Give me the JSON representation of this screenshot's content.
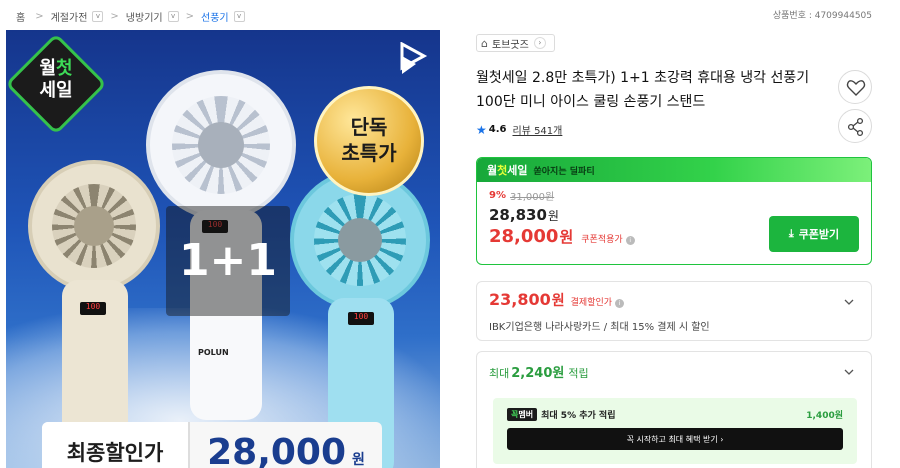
{
  "breadcrumb": {
    "items": [
      {
        "label": "홈"
      },
      {
        "label": "계절가전"
      },
      {
        "label": "냉방기기"
      },
      {
        "label": "선풍기"
      }
    ],
    "dropdown_glyph": "v"
  },
  "product_number": "상품번호 : 4709944505",
  "hero": {
    "badge_month_line1_a": "월",
    "badge_month_line1_b": "첫",
    "badge_month_line2": "세일",
    "badge_exclusive_line1": "단독",
    "badge_exclusive_line2": "초특가",
    "center_text": "1+1",
    "fan_display": "100",
    "fan_brand": "POLUN",
    "price_label": "최종할인가",
    "price_value": "28,000",
    "price_unit": "원"
  },
  "store": {
    "name": "토브굿즈",
    "arrow": "›"
  },
  "product": {
    "title": "월첫세일 2.8만 초특가) 1+1 초강력 휴대용 냉각 선풍기 100단 미니 아이스 쿨링 손풍기 스탠드",
    "rating": "4.6",
    "reviews_label": "리뷰 541개"
  },
  "deal": {
    "header_a": "월",
    "header_b": "첫",
    "header_c": "세일",
    "header_sub": "쏟아지는 딜파티",
    "discount_pct": "9%",
    "original_price": "31,000원",
    "current_price": "28,830",
    "current_unit": "원",
    "coupon_price": "28,000",
    "coupon_unit": "원",
    "coupon_label": "쿠폰적용가",
    "coupon_button": "쿠폰받기"
  },
  "card_payment": {
    "price": "23,800",
    "unit": "원",
    "label": "결제할인가",
    "desc": "IBK기업은행 나라사랑카드 / 최대 15% 결제 시 할인"
  },
  "card_points": {
    "prefix": "최대",
    "amount": "2,240원",
    "suffix": "적립",
    "member_chip_a": "꼭",
    "member_chip_b": "멤버",
    "member_text": "최대 5% 추가 적립",
    "member_points": "1,400원",
    "member_cta": "꼭 시작하고 최대 혜택 받기 ›"
  },
  "colors": {
    "accent_green": "#1cb53e",
    "price_red": "#e53935",
    "link_blue": "#1a73e8",
    "hero_navy": "#1a3d8f"
  },
  "icons": [
    "heart-icon",
    "share-icon",
    "store-icon",
    "star-icon",
    "download-icon",
    "chevron-down-icon",
    "info-icon"
  ]
}
